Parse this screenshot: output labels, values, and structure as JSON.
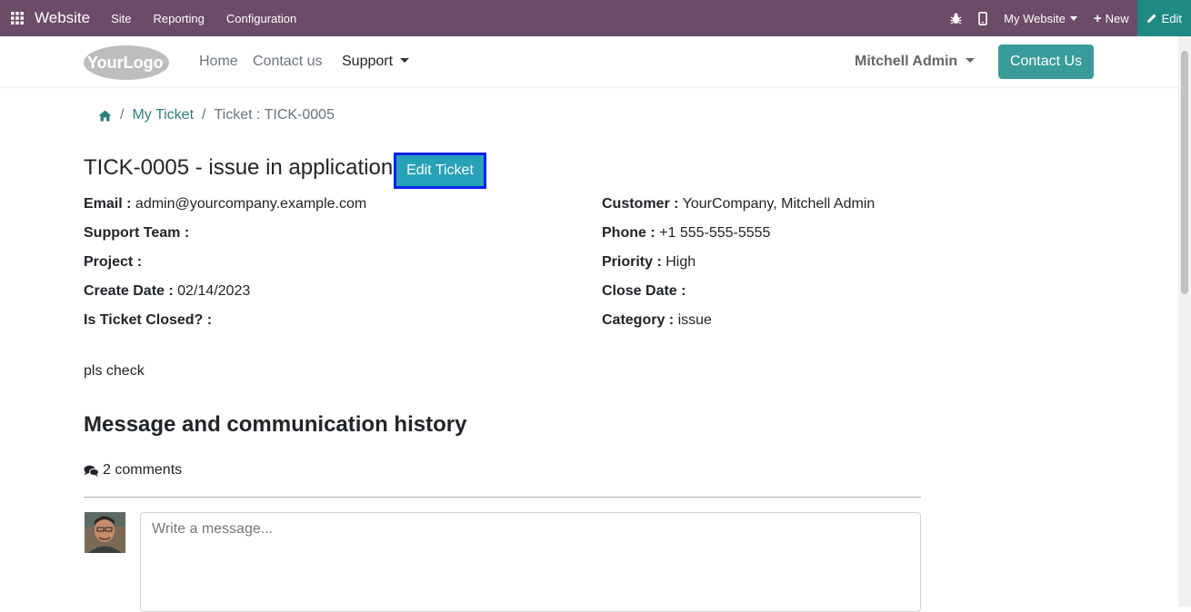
{
  "topbar": {
    "brand": "Website",
    "menu": [
      "Site",
      "Reporting",
      "Configuration"
    ],
    "website_selector": "My Website",
    "new_label": "New",
    "edit_label": "Edit"
  },
  "header": {
    "logo_text": "YourLogo",
    "nav": [
      "Home",
      "Contact us",
      "Support"
    ],
    "user": "Mitchell Admin",
    "contact_button": "Contact Us"
  },
  "breadcrumb": {
    "sep": "/",
    "my_ticket": "My Ticket",
    "current": "Ticket : TICK-0005"
  },
  "ticket": {
    "title": "TICK-0005 - issue in application",
    "edit_button": "Edit Ticket",
    "left_fields": [
      {
        "label": "Email :",
        "value": "admin@yourcompany.example.com"
      },
      {
        "label": "Support Team :",
        "value": ""
      },
      {
        "label": "Project :",
        "value": ""
      },
      {
        "label": "Create Date :",
        "value": "02/14/2023"
      },
      {
        "label": "Is Ticket Closed? :",
        "value": ""
      }
    ],
    "right_fields": [
      {
        "label": "Customer :",
        "value": "YourCompany, Mitchell Admin"
      },
      {
        "label": "Phone :",
        "value": "+1 555-555-5555"
      },
      {
        "label": "Priority :",
        "value": "High"
      },
      {
        "label": "Close Date :",
        "value": ""
      },
      {
        "label": "Category :",
        "value": "issue"
      }
    ],
    "description": "pls check"
  },
  "history": {
    "heading": "Message and communication history",
    "comments_count": "2 comments",
    "message_placeholder": "Write a message..."
  },
  "colors": {
    "topbar": "#6b4b67",
    "edit": "#1f8a84",
    "accent": "#3a9c9a",
    "edit_ticket": "#28a2b8",
    "focus_border": "#0022ee"
  }
}
